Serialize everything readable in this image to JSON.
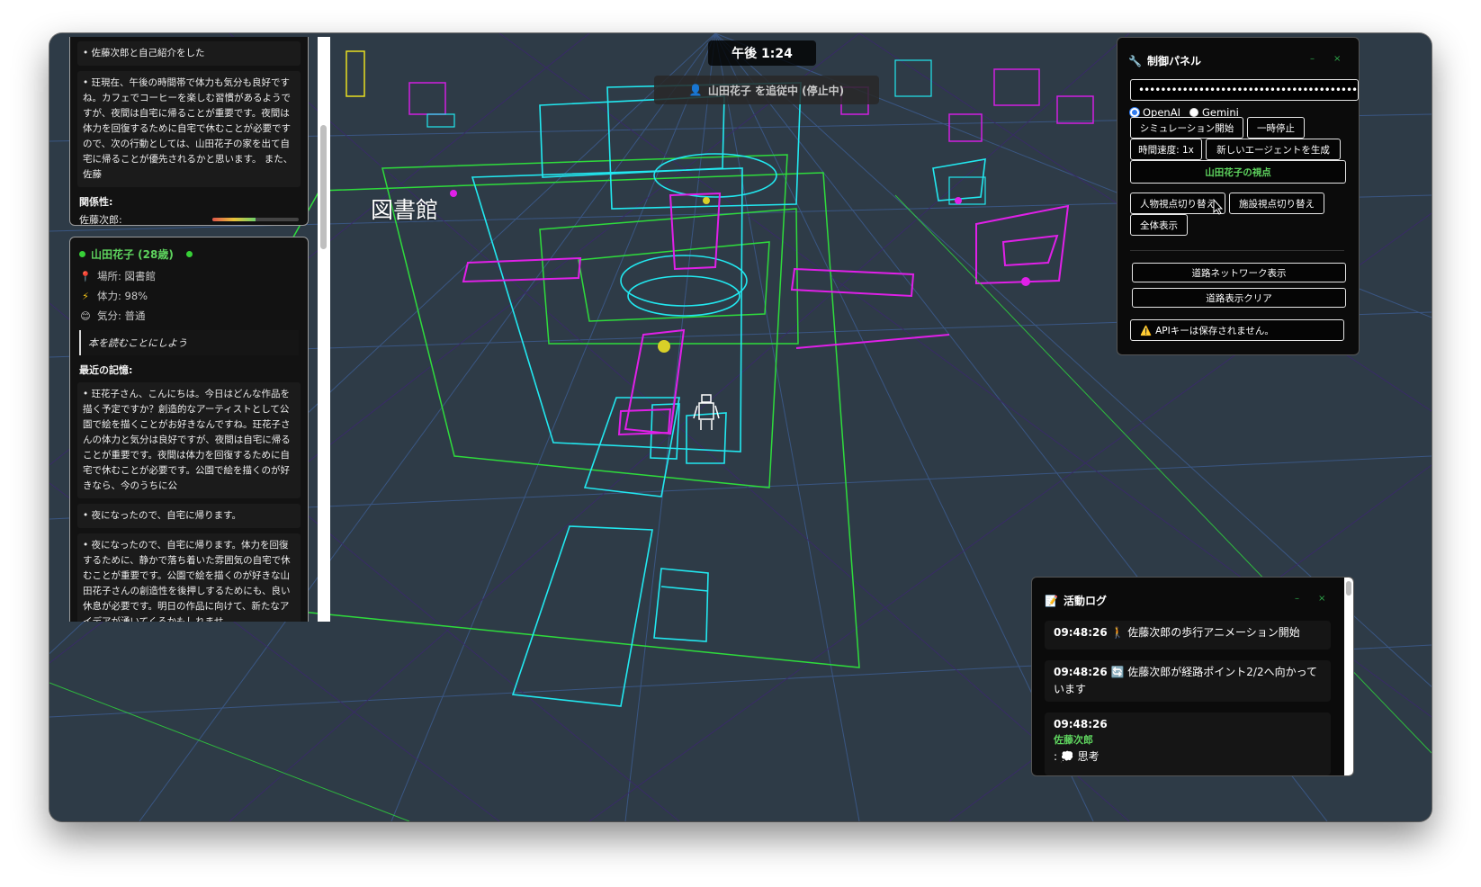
{
  "scene": {
    "clock": "午後 1:24",
    "follow_status": "山田花子 を追従中 (停止中)",
    "building_label": "図書館"
  },
  "left_panel": {
    "card1": {
      "memory_a": "• 佐藤次郎と自己紹介をした",
      "memory_b": "• 玨現在、午後の時間帯で体力も気分も良好ですね。カフェでコーヒーを楽しむ習慣があるようですが、夜間は自宅に帰ることが重要です。夜間は体力を回復するために自宅で休むことが必要ですので、次の行動としては、山田花子の家を出て自宅に帰ることが優先されるかと思います。 また、佐藤",
      "relations_title": "関係性:",
      "relation_name": "佐藤次郎:",
      "relation_level": 0.5
    },
    "card2": {
      "agent_name": "山田花子 (28歳)",
      "location": "場所: 図書館",
      "stamina": "体力: 98%",
      "mood": "気分: 普通",
      "thought": "本を読むことにしよう",
      "recent_memory_title": "最近の記憶:",
      "memories": [
        "• 玨花子さん、こんにちは。今日はどんな作品を描く予定ですか？創造的なアーティストとして公園で絵を描くことがお好きなんですね。玨花子さんの体力と気分は良好ですが、夜間は自宅に帰ることが重要です。夜間は体力を回復するために自宅で休むことが必要です。公園で絵を描くのが好きなら、今のうちに公",
        "• 夜になったので、自宅に帰ります。",
        "• 夜になったので、自宅に帰ります。体力を回復するために、静かで落ち着いた雰囲気の自宅で休むことが重要です。公園で絵を描くのが好きな山田花子さんの創造性を後押しするためにも、良い休息が必要です。明日の作品に向けて、新たなアイデアが湧いてくるかもしれませ"
      ]
    }
  },
  "control_panel": {
    "title": "制御パネル",
    "minimize": "–",
    "close": "×",
    "api_key_value": "••••••••••••••••••••••••••••••••••••••••••••••••••",
    "provider_openai": "OpenAI",
    "provider_gemini": "Gemini",
    "start_sim": "シミュレーション開始",
    "pause": "一時停止",
    "time_speed": "時間速度: 1x",
    "new_agent": "新しいエージェントを生成",
    "viewpoint": "山田花子の視点",
    "person_view": "人物視点切り替え",
    "facility_view": "施設視点切り替え",
    "show_all": "全体表示",
    "road_network": "道路ネットワーク表示",
    "road_clear": "道路表示クリア",
    "api_warning": "APIキーは保存されません。"
  },
  "activity_log": {
    "title": "活動ログ",
    "minimize": "–",
    "close": "×",
    "entries": [
      {
        "time": "09:48:26",
        "text": "🚶 佐藤次郎の歩行アニメーション開始"
      },
      {
        "time": "09:48:26",
        "text": "🔄 佐藤次郎が経路ポイント2/2へ向かっています"
      },
      {
        "time": "09:48:26",
        "agent": "佐藤次郎",
        "text": ": 💭 思考"
      }
    ]
  },
  "colors": {
    "ground": "#2d3a46",
    "wire_cyan": "#22e8f0",
    "wire_magenta": "#e020e8",
    "wire_green": "#2edc3c",
    "accent_green": "#5ed35e"
  }
}
